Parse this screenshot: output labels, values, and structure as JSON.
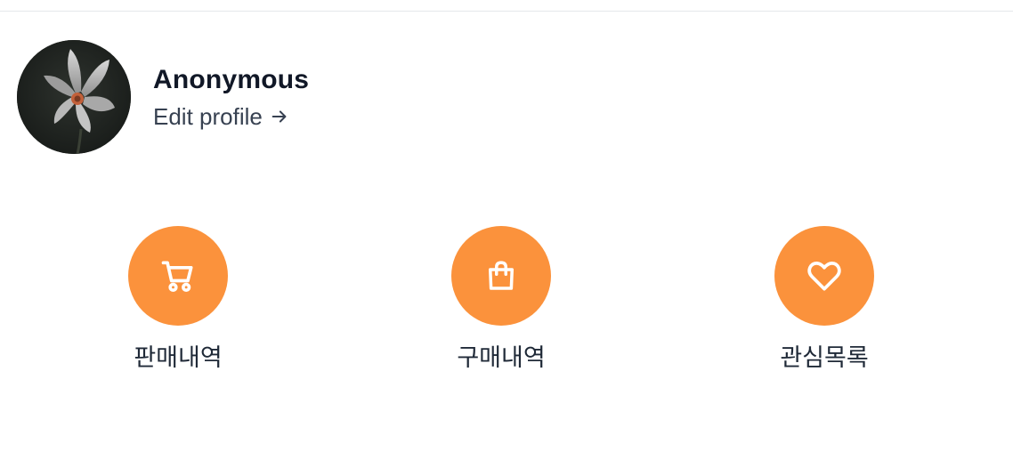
{
  "profile": {
    "name": "Anonymous",
    "edit_link": "Edit profile",
    "avatar_icon": "flower-photo"
  },
  "actions": [
    {
      "label": "판매내역",
      "icon": "cart-icon"
    },
    {
      "label": "구매내역",
      "icon": "shopping-bag-icon"
    },
    {
      "label": "관심목록",
      "icon": "heart-icon"
    }
  ],
  "colors": {
    "accent": "#fb923c",
    "text_primary": "#111827",
    "text_secondary": "#374151",
    "divider": "#e5e7eb"
  }
}
